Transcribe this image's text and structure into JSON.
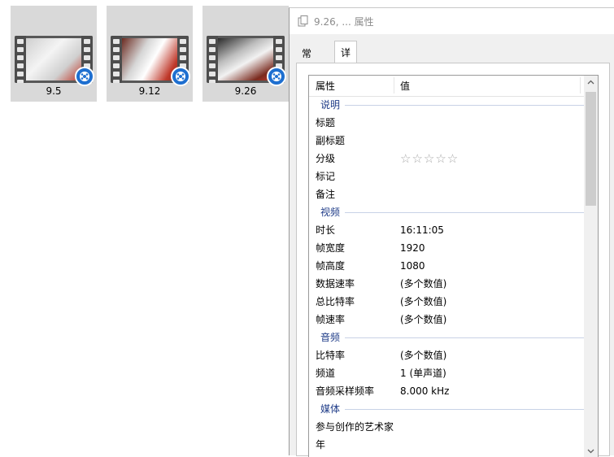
{
  "files": [
    {
      "label": "9.5"
    },
    {
      "label": "9.12"
    },
    {
      "label": "9.26"
    }
  ],
  "icons": {
    "video_badge": "video-badge-icon",
    "title_doc": "copy-document-icon",
    "rating_star": "star-outline-icon",
    "scroll_up": "chevron-up-icon",
    "scroll_down": "chevron-down-icon"
  },
  "colors": {
    "badge_blue": "#1e6fd0",
    "group_header": "#1f3c88",
    "title_text": "#8c8c8c"
  },
  "dialog": {
    "title": "9.26, ... 属性",
    "tabs": [
      {
        "label": "常规",
        "active": false
      },
      {
        "label": "详细信息",
        "active": true
      }
    ],
    "columns": {
      "property": "属性",
      "value": "值"
    },
    "rating_stars": "☆☆☆☆☆",
    "groups": [
      {
        "label": "说明",
        "rows": [
          {
            "name": "标题",
            "value": ""
          },
          {
            "name": "副标题",
            "value": ""
          },
          {
            "name": "分级",
            "value": ""
          },
          {
            "name": "标记",
            "value": ""
          },
          {
            "name": "备注",
            "value": ""
          }
        ]
      },
      {
        "label": "视频",
        "rows": [
          {
            "name": "时长",
            "value": "16:11:05"
          },
          {
            "name": "帧宽度",
            "value": "1920"
          },
          {
            "name": "帧高度",
            "value": "1080"
          },
          {
            "name": "数据速率",
            "value": "(多个数值)"
          },
          {
            "name": "总比特率",
            "value": "(多个数值)"
          },
          {
            "name": "帧速率",
            "value": "(多个数值)"
          }
        ]
      },
      {
        "label": "音频",
        "rows": [
          {
            "name": "比特率",
            "value": "(多个数值)"
          },
          {
            "name": "频道",
            "value": "1 (单声道)"
          },
          {
            "name": "音频采样频率",
            "value": "8.000 kHz"
          }
        ]
      },
      {
        "label": "媒体",
        "rows": [
          {
            "name": "参与创作的艺术家",
            "value": ""
          },
          {
            "name": "年",
            "value": ""
          }
        ]
      }
    ]
  }
}
